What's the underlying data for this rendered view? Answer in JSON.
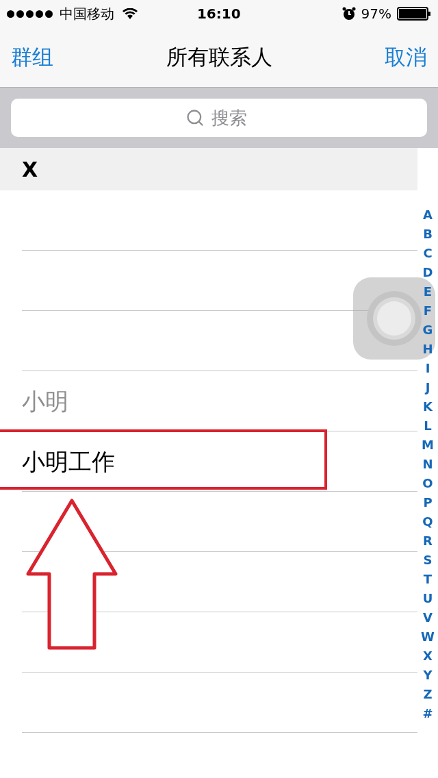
{
  "status_bar": {
    "carrier": "中国移动",
    "time": "16:10",
    "battery": "97%"
  },
  "nav": {
    "left": "群组",
    "title": "所有联系人",
    "right": "取消"
  },
  "search": {
    "placeholder": "搜索"
  },
  "section": {
    "title": "X"
  },
  "rows": [
    {
      "kind": "redacted"
    },
    {
      "kind": "redacted"
    },
    {
      "kind": "redacted"
    },
    {
      "kind": "contact",
      "name": "小明",
      "disabled": true,
      "highlighted": false
    },
    {
      "kind": "contact",
      "name": "小明工作",
      "disabled": false,
      "highlighted": true
    },
    {
      "kind": "redacted"
    },
    {
      "kind": "redacted"
    },
    {
      "kind": "redacted"
    },
    {
      "kind": "redacted"
    },
    {
      "kind": "redacted"
    }
  ],
  "index": [
    "A",
    "B",
    "C",
    "D",
    "E",
    "F",
    "G",
    "H",
    "I",
    "J",
    "K",
    "L",
    "M",
    "N",
    "O",
    "P",
    "Q",
    "R",
    "S",
    "T",
    "U",
    "V",
    "W",
    "X",
    "Y",
    "Z",
    "#"
  ]
}
